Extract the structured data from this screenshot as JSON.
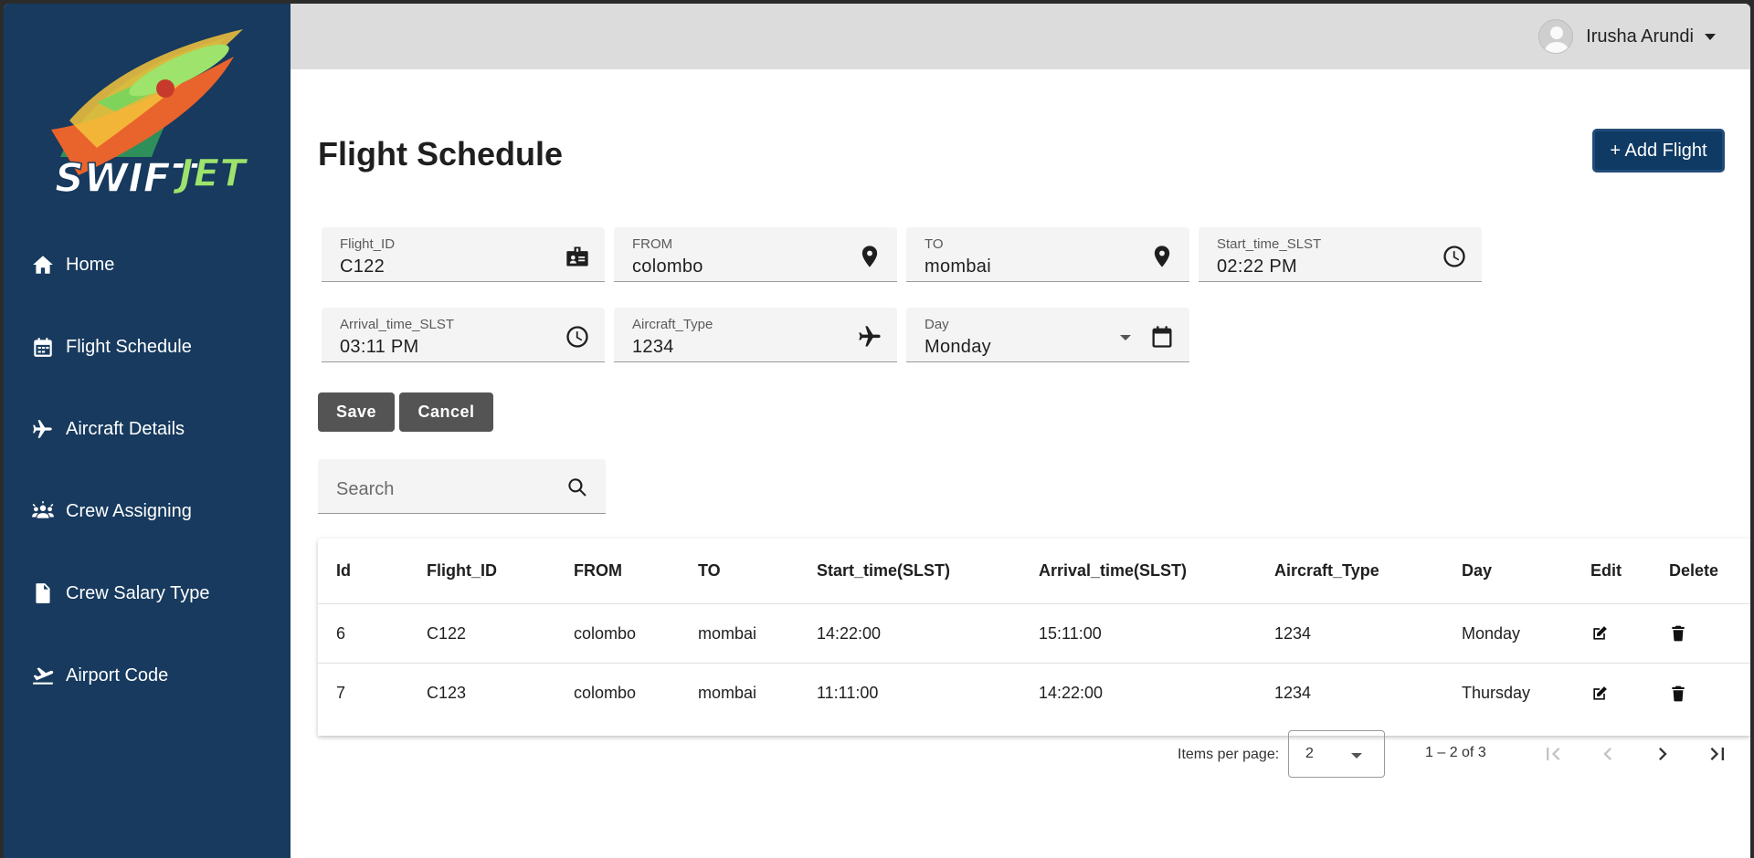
{
  "app": {
    "brand": "SWIFTJET"
  },
  "user": {
    "name": "Irusha Arundi"
  },
  "sidebar": {
    "items": [
      {
        "label": "Home",
        "icon": "home-icon"
      },
      {
        "label": "Flight Schedule",
        "icon": "calendar-icon"
      },
      {
        "label": "Aircraft Details",
        "icon": "plane-icon"
      },
      {
        "label": "Crew Assigning",
        "icon": "people-icon"
      },
      {
        "label": "Crew Salary Type",
        "icon": "document-icon"
      },
      {
        "label": "Airport Code",
        "icon": "takeoff-icon"
      }
    ]
  },
  "page": {
    "title": "Flight Schedule",
    "add_button": "+ Add Flight"
  },
  "form": {
    "flight_id": {
      "label": "Flight_ID",
      "value": "C122"
    },
    "from": {
      "label": "FROM",
      "value": "colombo"
    },
    "to": {
      "label": "TO",
      "value": "mombai"
    },
    "start_time": {
      "label": "Start_time_SLST",
      "value": "02:22 PM"
    },
    "arrival_time": {
      "label": "Arrival_time_SLST",
      "value": "03:11 PM"
    },
    "aircraft_type": {
      "label": "Aircraft_Type",
      "value": "1234"
    },
    "day": {
      "label": "Day",
      "value": "Monday"
    },
    "save_label": "Save",
    "cancel_label": "Cancel"
  },
  "search": {
    "placeholder": "Search"
  },
  "table": {
    "columns": [
      "Id",
      "Flight_ID",
      "FROM",
      "TO",
      "Start_time(SLST)",
      "Arrival_time(SLST)",
      "Aircraft_Type",
      "Day",
      "Edit",
      "Delete"
    ],
    "rows": [
      {
        "id": "6",
        "flight_id": "C122",
        "from": "colombo",
        "to": "mombai",
        "start": "14:22:00",
        "arrival": "15:11:00",
        "aircraft": "1234",
        "day": "Monday"
      },
      {
        "id": "7",
        "flight_id": "C123",
        "from": "colombo",
        "to": "mombai",
        "start": "11:11:00",
        "arrival": "14:22:00",
        "aircraft": "1234",
        "day": "Thursday"
      }
    ]
  },
  "paginator": {
    "items_per_page_label": "Items per page:",
    "page_size": "2",
    "range": "1 – 2 of 3"
  },
  "colors": {
    "sidebar": "#173a5e",
    "topbar": "#dcdcdc",
    "primary": "#0f3a63",
    "button": "#545454"
  }
}
